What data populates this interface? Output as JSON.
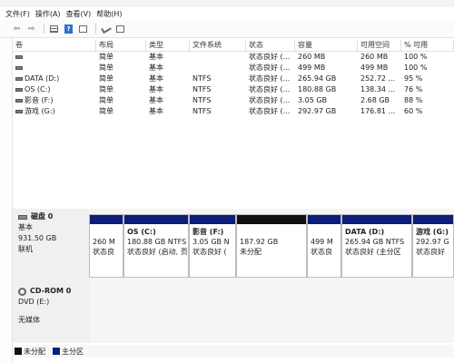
{
  "menu": {
    "file": "文件(F)",
    "action": "操作(A)",
    "view": "查看(V)",
    "help": "帮助(H)"
  },
  "toolbar": {
    "back": "⇦",
    "forward": "⇨"
  },
  "table": {
    "headers": [
      "卷",
      "布局",
      "类型",
      "文件系统",
      "状态",
      "容量",
      "可用空间",
      "% 可用"
    ],
    "rows": [
      [
        "",
        "简单",
        "基本",
        "",
        "状态良好 (...",
        "260 MB",
        "260 MB",
        "100 %"
      ],
      [
        "",
        "简单",
        "基本",
        "",
        "状态良好 (...",
        "499 MB",
        "499 MB",
        "100 %"
      ],
      [
        "DATA (D:)",
        "简单",
        "基本",
        "NTFS",
        "状态良好 (...",
        "265.94 GB",
        "252.72 ...",
        "95 %"
      ],
      [
        "OS (C:)",
        "简单",
        "基本",
        "NTFS",
        "状态良好 (...",
        "180.88 GB",
        "138.34 ...",
        "76 %"
      ],
      [
        "影音 (F:)",
        "简单",
        "基本",
        "NTFS",
        "状态良好 (...",
        "3.05 GB",
        "2.68 GB",
        "88 %"
      ],
      [
        "游戏 (G:)",
        "简单",
        "基本",
        "NTFS",
        "状态良好 (...",
        "292.97 GB",
        "176.81 ...",
        "60 %"
      ]
    ]
  },
  "disk0": {
    "name": "磁盘 0",
    "type": "基本",
    "size": "931.50 GB",
    "status": "联机",
    "partitions": [
      {
        "title": "",
        "line1": "260 M",
        "line2": "状态良"
      },
      {
        "title": "OS (C:)",
        "line1": "180.88 GB NTFS",
        "line2": "状态良好 (启动, 页"
      },
      {
        "title": "影音 (F:)",
        "line1": "3.05 GB N",
        "line2": "状态良好 ("
      },
      {
        "title": "",
        "line1": "187.92 GB",
        "line2": "未分配"
      },
      {
        "title": "",
        "line1": "499 M",
        "line2": "状态良"
      },
      {
        "title": "DATA (D:)",
        "line1": "265.94 GB NTFS",
        "line2": "状态良好 (主分区"
      },
      {
        "title": "游戏 (G:)",
        "line1": "292.97 G",
        "line2": "状态良好"
      }
    ]
  },
  "cdrom": {
    "name": "CD-ROM 0",
    "drive": "DVD (E:)",
    "status": "无媒体"
  },
  "legend": {
    "unallocated": "未分配",
    "primary": "主分区"
  },
  "colors": {
    "primary": "#0b1e7c",
    "unallocated": "#111111"
  }
}
